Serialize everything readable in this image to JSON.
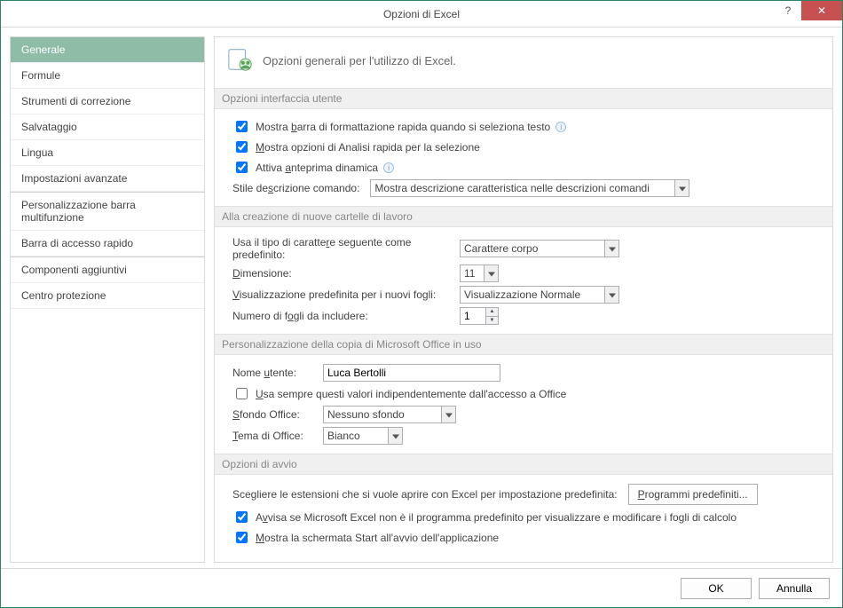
{
  "window": {
    "title": "Opzioni di Excel"
  },
  "sidebar": {
    "items": [
      "Generale",
      "Formule",
      "Strumenti di correzione",
      "Salvataggio",
      "Lingua",
      "Impostazioni avanzate",
      "Personalizzazione barra multifunzione",
      "Barra di accesso rapido",
      "Componenti aggiuntivi",
      "Centro protezione"
    ],
    "selected_index": 0
  },
  "header": {
    "text": "Opzioni generali per l'utilizzo di Excel."
  },
  "sections": {
    "ui": {
      "title": "Opzioni interfaccia utente",
      "chk_miniToolbar": {
        "label": "Mostra barra di formattazione rapida quando si seleziona testo",
        "checked": true,
        "info": true
      },
      "chk_quickAnalysis": {
        "label": "Mostra opzioni di Analisi rapida per la selezione",
        "checked": true
      },
      "chk_livePreview": {
        "label": "Attiva anteprima dinamica",
        "checked": true,
        "info": true
      },
      "tooltipStyle": {
        "label": "Stile descrizione comando:",
        "value": "Mostra descrizione caratteristica nelle descrizioni comandi"
      }
    },
    "newWb": {
      "title": "Alla creazione di nuove cartelle di lavoro",
      "font": {
        "label": "Usa il tipo di carattere seguente come predefinito:",
        "value": "Carattere corpo"
      },
      "size": {
        "label": "Dimensione:",
        "value": "11"
      },
      "view": {
        "label": "Visualizzazione predefinita per i nuovi fogli:",
        "value": "Visualizzazione Normale"
      },
      "sheets": {
        "label": "Numero di fogli da includere:",
        "value": "1"
      }
    },
    "personal": {
      "title": "Personalizzazione della copia di Microsoft Office in uso",
      "username": {
        "label": "Nome utente:",
        "value": "Luca Bertolli"
      },
      "always": {
        "label": "Usa sempre questi valori indipendentemente dall'accesso a Office",
        "checked": false
      },
      "bg": {
        "label": "Sfondo Office:",
        "value": "Nessuno sfondo"
      },
      "theme": {
        "label": "Tema di Office:",
        "value": "Bianco"
      }
    },
    "startup": {
      "title": "Opzioni di avvio",
      "extLabel": "Scegliere le estensioni che si vuole aprire con Excel per impostazione predefinita:",
      "extButton": "Programmi predefiniti...",
      "warn": {
        "label": "Avvisa se Microsoft Excel non è il programma predefinito per visualizzare e modificare i fogli di calcolo",
        "checked": true
      },
      "start": {
        "label": "Mostra la schermata Start all'avvio dell'applicazione",
        "checked": true
      }
    }
  },
  "footer": {
    "ok": "OK",
    "cancel": "Annulla"
  }
}
